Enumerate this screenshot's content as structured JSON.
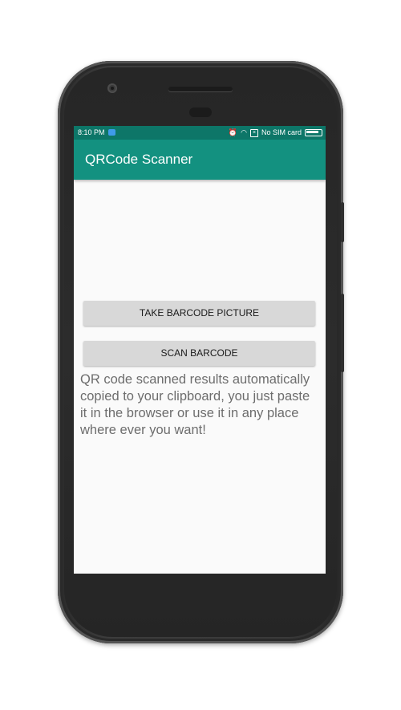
{
  "status_bar": {
    "time": "8:10 PM",
    "sim_status": "No SIM card"
  },
  "app_bar": {
    "title": "QRCode Scanner"
  },
  "buttons": {
    "take_picture": "TAKE BARCODE PICTURE",
    "scan_barcode": "SCAN BARCODE"
  },
  "info_text": "QR code scanned results automatically copied to your clipboard, you just paste it in the browser or use it in any place where ever you want!",
  "colors": {
    "status_bar": "#0d7668",
    "app_bar": "#139180",
    "button_bg": "#d8d8d8",
    "screen_bg": "#fafafa"
  }
}
